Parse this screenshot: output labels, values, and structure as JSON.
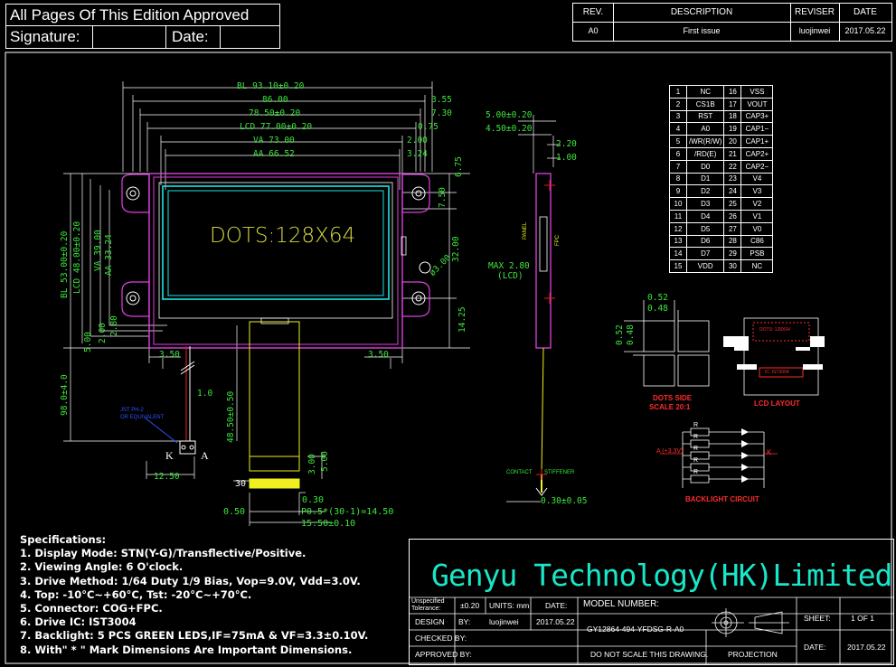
{
  "approval": {
    "line1": "All Pages Of This Edition Approved",
    "signature": "Signature:",
    "date": "Date:"
  },
  "revision": {
    "headers": [
      "REV.",
      "DESCRIPTION",
      "REVISER",
      "DATE"
    ],
    "row": [
      "A0",
      "First issue",
      "luojinwei",
      "2017.05.22"
    ]
  },
  "front_view": {
    "dims_top": [
      "BL 93.10±0.20",
      "86.00",
      "78.50±0.20",
      "LCD 77.00±0.20",
      "VA 73.00",
      "AA 66.52"
    ],
    "dims_top_right": [
      "3.55",
      "7.30",
      "0.75",
      "2.00",
      "3.24"
    ],
    "dims_right": [
      "6.75",
      "7.50",
      "32.00",
      "14.25"
    ],
    "dims_left": [
      "BL 53.00±0.20",
      "LCD 48.00±0.20",
      "VA 39.00",
      "AA 33.24",
      "2.80",
      "2.00",
      "5.00",
      "98.0±4.0"
    ],
    "dims_bottom": [
      "3.50",
      "3.50",
      "1.0",
      "48.50±0.50",
      "12.50",
      "3.00",
      "5.00"
    ],
    "hole": "ø3.00",
    "dots_label": "DOTS:128X64",
    "ka": [
      "K",
      "A"
    ],
    "jst_note": [
      "JST PH-2",
      "OR EQUIVALENT"
    ]
  },
  "fpc_detail": {
    "pin_label": "30",
    "labels": [
      "0.30",
      "0.50",
      "P0.5*(30-1)=14.50",
      "15.50±0.10"
    ]
  },
  "side_view": {
    "dims": [
      "5.00±0.20",
      "4.50±0.20",
      "2.20",
      "1.00",
      "MAX 2.80",
      "(LCD)",
      "0.30±0.05"
    ],
    "contact_label": "CONTACT",
    "stiffener_label": "STIFFENER",
    "small_labels": [
      "PANEL",
      "FPC"
    ]
  },
  "pins": [
    [
      "1",
      "NC",
      "16",
      "VSS"
    ],
    [
      "2",
      "CS1B",
      "17",
      "VOUT"
    ],
    [
      "3",
      "RST",
      "18",
      "CAP3+"
    ],
    [
      "4",
      "A0",
      "19",
      "CAP1−"
    ],
    [
      "5",
      "/WR(R/W)",
      "20",
      "CAP1+"
    ],
    [
      "6",
      "/RD(E)",
      "21",
      "CAP2+"
    ],
    [
      "7",
      "D0",
      "22",
      "CAP2−"
    ],
    [
      "8",
      "D1",
      "23",
      "V4"
    ],
    [
      "9",
      "D2",
      "24",
      "V3"
    ],
    [
      "10",
      "D3",
      "25",
      "V2"
    ],
    [
      "11",
      "D4",
      "26",
      "V1"
    ],
    [
      "12",
      "D5",
      "27",
      "V0"
    ],
    [
      "13",
      "D6",
      "28",
      "C86"
    ],
    [
      "14",
      "D7",
      "29",
      "PSB"
    ],
    [
      "15",
      "VDD",
      "30",
      "NC"
    ]
  ],
  "dots_side": {
    "dims": [
      "0.52",
      "0.48",
      "0.52",
      "0.48"
    ],
    "title": "DOTS SIDE",
    "scale": "SCALE 20:1"
  },
  "lcd_layout": {
    "title": "LCD LAYOUT",
    "top_label": "DOTS: 128X64",
    "bottom_label": "IC: IST3004"
  },
  "backlight": {
    "title": "BACKLIGHT CIRCUIT",
    "anode": "A (+3.3V)",
    "k": "K",
    "r": "R"
  },
  "specs": [
    "Specifications:",
    "1. Display Mode: STN(Y-G)/Transflective/Positive.",
    "2. Viewing Angle:  6 O'clock.",
    "3. Drive Method: 1/64 Duty 1/9 Bias, Vop=9.0V, Vdd=3.0V.",
    "4. Top: -10°C~+60°C, Tst: -20°C~+70°C.",
    "5. Connector:  COG+FPC.",
    "6. Drive IC: IST3004",
    "7. Backlight: 5 PCS GREEN LEDS,IF=75mA & VF=3.3±0.10V.",
    "8. With\" * \" Mark Dimensions Are Important Dimensions."
  ],
  "title_block": {
    "company": "Genyu Technology(HK)Limited",
    "unspecified": [
      "Unspecified",
      "Tolerance:"
    ],
    "tolerance": "±0.20",
    "units": "UNITS: mm",
    "date_label": "DATE:",
    "model_label": "MODEL NUMBER:",
    "model": "GY12864-494-YFDSG-R-A0",
    "design_label": "DESIGN",
    "by": "BY:",
    "designer": "luojinwei",
    "design_date": "2017.05.22",
    "checked": "CHECKED BY:",
    "approved": "APPROVED BY:",
    "noscale": "DO NOT SCALE THIS DRAWING.",
    "projection": "PROJECTION",
    "sheet_label": "SHEET:",
    "sheet": "1 OF 1",
    "date_label2": "DATE:",
    "date": "2017.05.22"
  }
}
